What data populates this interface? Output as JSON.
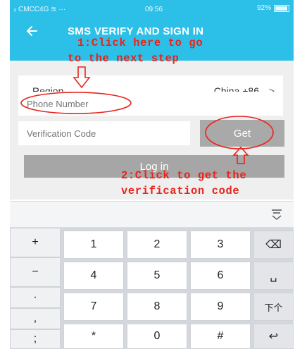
{
  "status_bar": {
    "carrier": "ᵢₗ CMCC4G ≋ ···",
    "time": "09:56",
    "battery": "92%"
  },
  "header": {
    "title": "SMS VERIFY AND SIGN IN"
  },
  "form": {
    "region_label": "Region",
    "region_value": "China +86",
    "region_chevron": ">",
    "phone_placeholder": "Phone Number",
    "code_placeholder": "Verification Code",
    "get_label": "Get",
    "login_label": "Log in"
  },
  "annotations": {
    "step1_line1": "1:Click here to go",
    "step1_line2": "to the next step",
    "step2_line1": "2:Click to get the",
    "step2_line2": "verification code"
  },
  "keyboard": {
    "symbols": [
      "+",
      "−",
      "·",
      ",",
      ";"
    ],
    "digits": [
      "1",
      "2",
      "3",
      "4",
      "5",
      "6",
      "7",
      "8",
      "9",
      "*",
      "0",
      "#"
    ],
    "functions": [
      "⌫",
      "␣",
      "下个",
      "↩"
    ]
  },
  "colors": {
    "header": "#2cc0e8",
    "annotation": "#e8231b",
    "button_gray": "#a6a6a6"
  }
}
